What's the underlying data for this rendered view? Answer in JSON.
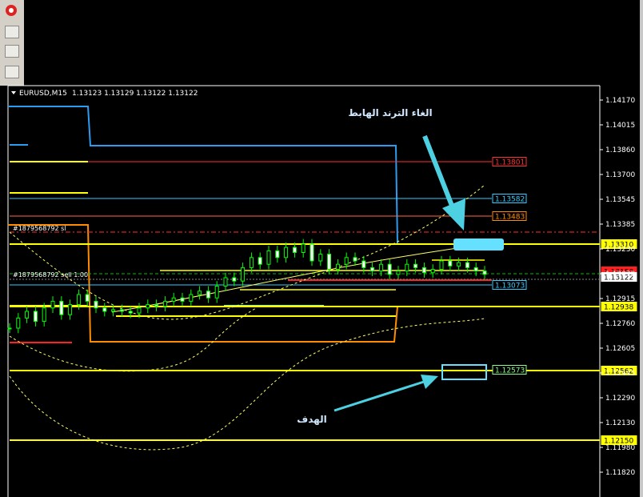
{
  "header": {
    "symbol": "EURUSD,M15",
    "ohlc": "1.13123 1.13129 1.13122 1.13122"
  },
  "annotations": {
    "cancel_downtrend": "الغاء الترند الهابط",
    "target": "الهدف"
  },
  "orders": {
    "sl_label": "#1879568792 sl",
    "sell_label": "#1879568792 sell 1.00"
  },
  "colors": {
    "background": "#000000",
    "axis": "#ffffff",
    "candle": "#00ff00",
    "yellow": "#ffff00",
    "blue": "#1e90ff",
    "orange": "#ff8c00",
    "red": "#ff0000",
    "cyan": "#66e0ff",
    "arrow": "#4dd0e1"
  },
  "chart_data": {
    "type": "line",
    "title": "EURUSD,M15",
    "yaxis_ticks": [
      "1.14170",
      "1.14015",
      "1.13860",
      "1.13700",
      "1.13545",
      "1.13385",
      "1.13230",
      "1.13070",
      "1.12915",
      "1.12760",
      "1.12605",
      "1.12445",
      "1.12290",
      "1.12130",
      "1.11980",
      "1.11820"
    ],
    "ylim": [
      1.1179,
      1.1427
    ],
    "levels": [
      {
        "label": "1.13801",
        "value": 1.13801,
        "color": "#ff3030"
      },
      {
        "label": "1.13582",
        "value": 1.13582,
        "color": "#33ccff"
      },
      {
        "label": "1.13483",
        "value": 1.13483,
        "color": "#ff8c00"
      },
      {
        "label": "1.13310",
        "value": 1.1331,
        "color": "#ffff00"
      },
      {
        "label": "1.13150",
        "value": 1.1315,
        "color": "#ff3030"
      },
      {
        "label": "1.13122",
        "value": 1.13122,
        "color": "#ffffff"
      },
      {
        "label": "1.13073",
        "value": 1.13073,
        "color": "#33ccff"
      },
      {
        "label": "1.12938",
        "value": 1.12938,
        "color": "#ffff00"
      },
      {
        "label": "1.12573",
        "value": 1.12573,
        "color": "#88ff88"
      },
      {
        "label": "1.12562",
        "value": 1.12562,
        "color": "#ffff00"
      },
      {
        "label": "1.12150",
        "value": 1.1215,
        "color": "#ffff00"
      }
    ],
    "price_series": [
      1.128,
      1.1286,
      1.129,
      1.1284,
      1.1292,
      1.1296,
      1.1288,
      1.1294,
      1.13,
      1.1296,
      1.1292,
      1.129,
      1.1291,
      1.129,
      1.1289,
      1.1292,
      1.1294,
      1.1293,
      1.1296,
      1.1298,
      1.1296,
      1.13,
      1.1302,
      1.1298,
      1.1305,
      1.131,
      1.1308,
      1.1316,
      1.1322,
      1.1318,
      1.1326,
      1.1322,
      1.1328,
      1.1325,
      1.133,
      1.132,
      1.1324,
      1.1315,
      1.1318,
      1.1322,
      1.132,
      1.1316,
      1.1314,
      1.1318,
      1.1312,
      1.1314,
      1.1318,
      1.1316,
      1.1313,
      1.1315,
      1.132,
      1.1317,
      1.1319,
      1.1316,
      1.1314,
      1.1312
    ]
  }
}
